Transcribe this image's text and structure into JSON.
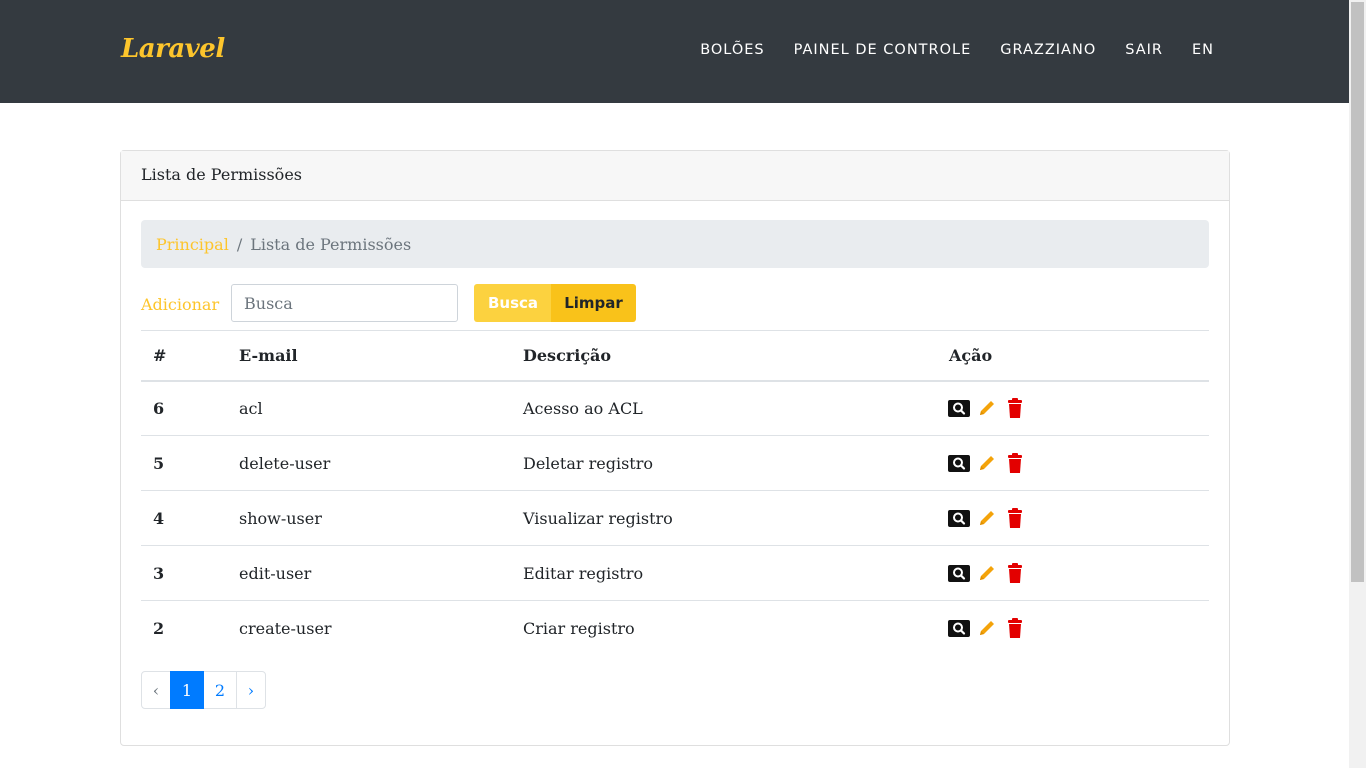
{
  "navbar": {
    "brand": "Laravel",
    "items": [
      "BOLÕES",
      "PAINEL DE CONTROLE",
      "GRAZZIANO",
      "SAIR",
      "EN"
    ]
  },
  "card": {
    "header": "Lista de Permissões",
    "breadcrumb": {
      "home": "Principal",
      "separator": "/",
      "current": "Lista de Permissões"
    }
  },
  "toolbar": {
    "add_label": "Adicionar",
    "search_placeholder": "Busca",
    "search_button": "Busca",
    "clear_button": "Limpar"
  },
  "table": {
    "columns": [
      "#",
      "E-mail",
      "Descrição",
      "Ação"
    ],
    "rows": [
      {
        "id": "6",
        "email": "acl",
        "description": "Acesso ao ACL"
      },
      {
        "id": "5",
        "email": "delete-user",
        "description": "Deletar registro"
      },
      {
        "id": "4",
        "email": "show-user",
        "description": "Visualizar registro"
      },
      {
        "id": "3",
        "email": "edit-user",
        "description": "Editar registro"
      },
      {
        "id": "2",
        "email": "create-user",
        "description": "Criar registro"
      }
    ],
    "action_icons": [
      "search-icon",
      "pencil-icon",
      "trash-icon"
    ]
  },
  "pagination": {
    "prev": "‹",
    "pages": [
      "1",
      "2"
    ],
    "next": "›",
    "active": "1"
  },
  "colors": {
    "navbar": "#343a40",
    "accent": "#fdc52c",
    "primary": "#007bff",
    "danger": "#e30000"
  }
}
